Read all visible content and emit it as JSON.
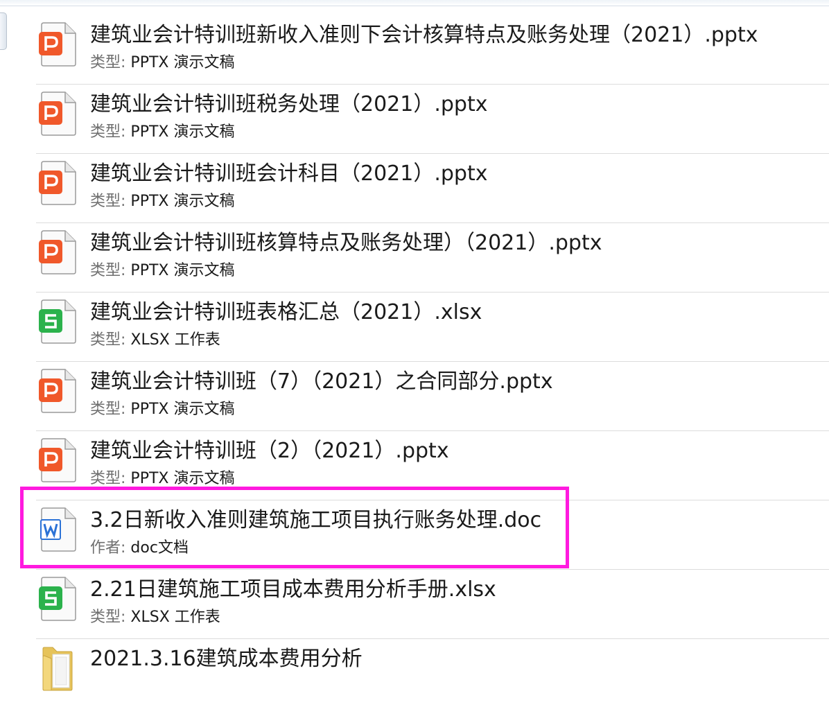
{
  "files": [
    {
      "name": "建筑业会计特训班新收入准则下会计核算特点及账务处理（2021）.pptx",
      "meta_label": "类型:",
      "meta_value": "PPTX 演示文稿",
      "icon": "pptx-file-icon"
    },
    {
      "name": "建筑业会计特训班税务处理（2021）.pptx",
      "meta_label": "类型:",
      "meta_value": "PPTX 演示文稿",
      "icon": "pptx-file-icon"
    },
    {
      "name": "建筑业会计特训班会计科目（2021）.pptx",
      "meta_label": "类型:",
      "meta_value": "PPTX 演示文稿",
      "icon": "pptx-file-icon"
    },
    {
      "name": "建筑业会计特训班核算特点及账务处理）（2021）.pptx",
      "meta_label": "类型:",
      "meta_value": "PPTX 演示文稿",
      "icon": "pptx-file-icon"
    },
    {
      "name": "建筑业会计特训班表格汇总（2021）.xlsx",
      "meta_label": "类型:",
      "meta_value": "XLSX 工作表",
      "icon": "xlsx-file-icon"
    },
    {
      "name": "建筑业会计特训班（7）（2021）之合同部分.pptx",
      "meta_label": "类型:",
      "meta_value": "PPTX 演示文稿",
      "icon": "pptx-file-icon"
    },
    {
      "name": "建筑业会计特训班（2）（2021）.pptx",
      "meta_label": "类型:",
      "meta_value": "PPTX 演示文稿",
      "icon": "pptx-file-icon"
    },
    {
      "name": "3.2日新收入准则建筑施工项目执行账务处理.doc",
      "meta_label": "作者:",
      "meta_value": "doc文档",
      "icon": "doc-file-icon"
    },
    {
      "name": "2.21日建筑施工项目成本费用分析手册.xlsx",
      "meta_label": "类型:",
      "meta_value": "XLSX 工作表",
      "icon": "xlsx-file-icon"
    },
    {
      "name": "2021.3.16建筑成本费用分析",
      "meta_label": "",
      "meta_value": "",
      "icon": "folder-icon"
    }
  ],
  "colors": {
    "pptx": "#f0582a",
    "xlsx": "#2bb24c",
    "doc": "#2b72d6",
    "folder": "#f1d67c",
    "highlight": "#ff1adf"
  }
}
